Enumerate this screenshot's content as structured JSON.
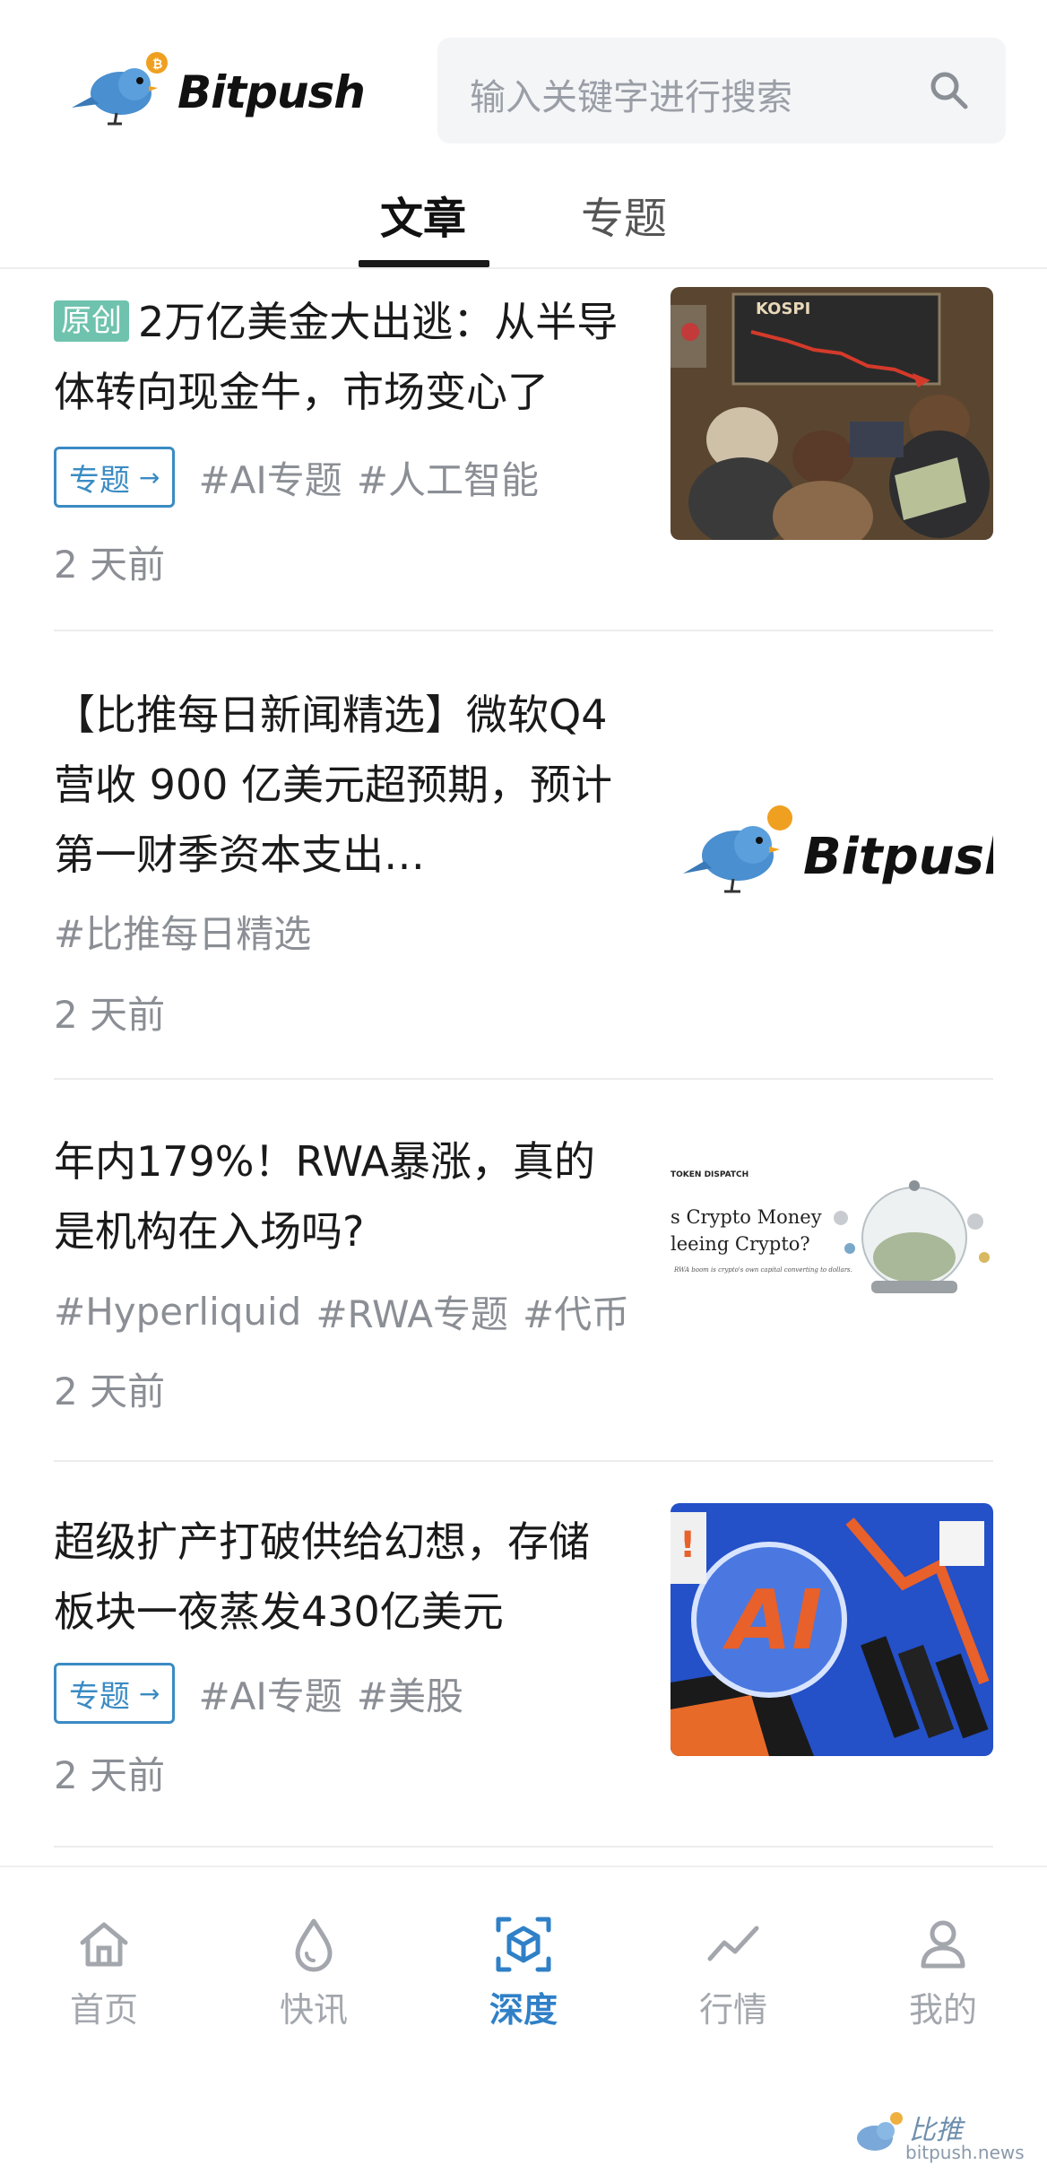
{
  "header": {
    "logo_text": "Bitpush",
    "search_placeholder": "输入关键字进行搜索"
  },
  "tabs": [
    {
      "label": "文章",
      "active": true
    },
    {
      "label": "专题",
      "active": false
    }
  ],
  "articles": [
    {
      "badge": "原创",
      "title": "2万亿美金大出逃：从半导体转向现金牛，市场变心了",
      "topic_label": "专题",
      "tags": [
        "#AI专题",
        "#人工智能"
      ],
      "time": "2 天前",
      "image_text": "KOSPI"
    },
    {
      "title": "【比推每日新闻精选】微软Q4 营收 900 亿美元超预期，预计第一财季资本支出…",
      "tags": [
        "#比推每日精选"
      ],
      "time": "2 天前",
      "image_text": "Bitpush"
    },
    {
      "title": "年内179%！RWA暴涨，真的是机构在入场吗?",
      "tags": [
        "#Hyperliquid",
        "#RWA专题",
        "#代币"
      ],
      "time": "2 天前",
      "image_texts": [
        "TOKEN DISPATCH",
        "s Crypto Money",
        "leeing Crypto?",
        "RWA boom is crypto's own capital converting to dollars."
      ]
    },
    {
      "title": "超级扩产打破供给幻想，存储板块一夜蒸发430亿美元",
      "topic_label": "专题",
      "tags": [
        "#AI专题",
        "#美股"
      ],
      "time": "2 天前",
      "image_text": "AI"
    }
  ],
  "bottom_nav": [
    {
      "label": "首页",
      "icon": "home-icon",
      "active": false
    },
    {
      "label": "快讯",
      "icon": "drop-icon",
      "active": false
    },
    {
      "label": "深度",
      "icon": "cube-icon",
      "active": true
    },
    {
      "label": "行情",
      "icon": "chart-line-icon",
      "active": false
    },
    {
      "label": "我的",
      "icon": "user-icon",
      "active": false
    }
  ],
  "watermark": {
    "title": "比推",
    "url": "bitpush.news"
  },
  "colors": {
    "accent": "#2f80c7",
    "badge_green": "#6fc3ae",
    "topic_blue": "#3a8bc3",
    "muted": "#8b8f95"
  }
}
